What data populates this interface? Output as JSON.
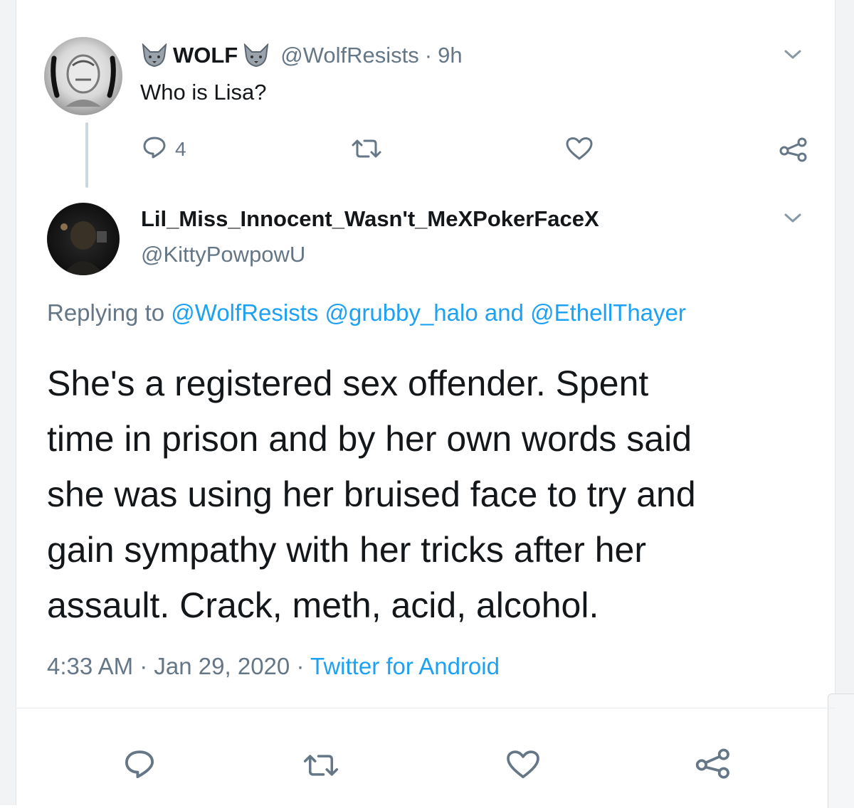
{
  "parent_tweet": {
    "display_name": "WOLF",
    "handle": "@WolfResists",
    "separator": "·",
    "time": "9h",
    "text": "Who is Lisa?",
    "reply_count": "4",
    "icons": {
      "reply": "reply-bubble-icon",
      "retweet": "retweet-icon",
      "like": "heart-icon",
      "share": "share-icon",
      "menu": "chevron-down-icon"
    }
  },
  "reply_tweet": {
    "display_name": "Lil_Miss_Innocent_Wasn't_MeXPokerFaceX",
    "handle": "@KittyPowpowU",
    "replying_prefix": "Replying to",
    "replying_mentions": [
      "@WolfResists",
      "@grubby_halo",
      "@EthellThayer"
    ],
    "replying_and": "and",
    "text_lines": [
      "She's a registered sex offender. Spent",
      "time in prison and by her own words said",
      "she was using her bruised face to try and",
      "gain sympathy with her tricks after her",
      "assault. Crack, meth, acid, alcohol."
    ],
    "time": "4:33 AM",
    "date": "Jan 29, 2020",
    "separator": "·",
    "source": "Twitter for Android"
  },
  "colors": {
    "text": "#14171a",
    "secondary": "#657786",
    "link": "#1da1f2",
    "divider": "#e6ecf0"
  }
}
